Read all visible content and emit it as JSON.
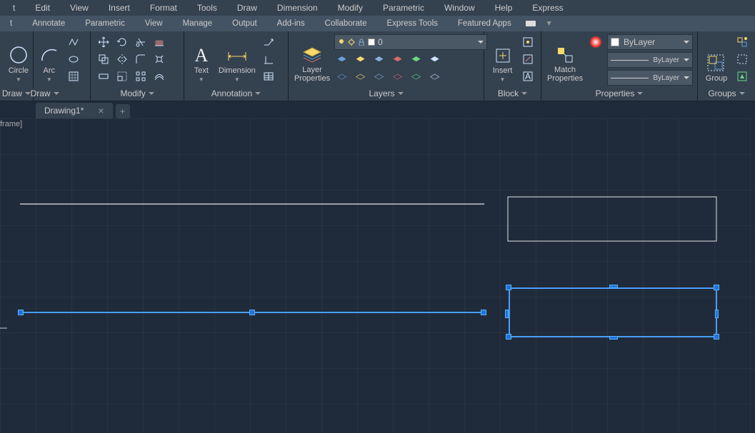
{
  "menubar": [
    "t",
    "Edit",
    "View",
    "Insert",
    "Format",
    "Tools",
    "Draw",
    "Dimension",
    "Modify",
    "Parametric",
    "Window",
    "Help",
    "Express"
  ],
  "tabstrip": [
    "t",
    "Annotate",
    "Parametric",
    "View",
    "Manage",
    "Output",
    "Add-ins",
    "Collaborate",
    "Express Tools",
    "Featured Apps"
  ],
  "panels": {
    "draw": {
      "title": "Draw",
      "circle": "Circle",
      "arc": "Arc"
    },
    "modify": {
      "title": "Modify"
    },
    "annotation": {
      "title": "Annotation",
      "text": "Text",
      "dimension": "Dimension"
    },
    "layers": {
      "title": "Layers",
      "layerprops": "Layer\nProperties",
      "current": "0"
    },
    "block": {
      "title": "Block",
      "insert": "Insert"
    },
    "properties": {
      "title": "Properties",
      "match": "Match\nProperties",
      "bylayer": "ByLayer"
    },
    "groups": {
      "title": "Groups",
      "group": "Group"
    }
  },
  "doc": {
    "name": "Drawing1*"
  },
  "viewport_label": "frame]"
}
